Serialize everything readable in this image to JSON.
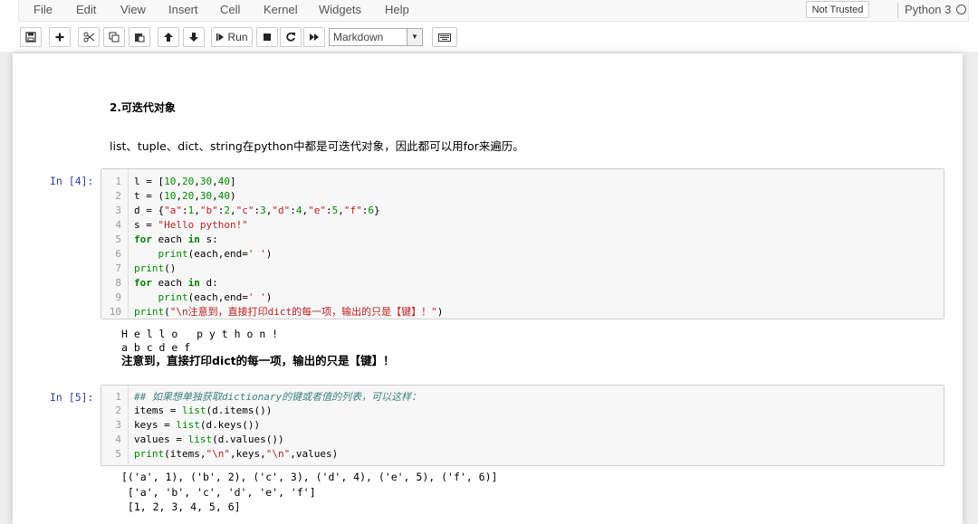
{
  "menu": [
    "File",
    "Edit",
    "View",
    "Insert",
    "Cell",
    "Kernel",
    "Widgets",
    "Help"
  ],
  "trusted_label": "Not Trusted",
  "kernel_name": "Python 3",
  "toolbar": {
    "run_label": "Run",
    "cell_type": "Markdown"
  },
  "markdown": {
    "heading": "2.可迭代对象",
    "paragraph": "list、tuple、dict、string在python中都是可迭代对象，因此都可以用for来遍历。"
  },
  "cells": [
    {
      "prompt": "In  [4]:",
      "lines": [
        "l = [10,20,30,40]",
        "t = (10,20,30,40)",
        "d = {\"a\":1,\"b\":2,\"c\":3,\"d\":4,\"e\":5,\"f\":6}",
        "s = \"Hello python!\"",
        "for each in s:",
        "    print(each,end=' ')",
        "print()",
        "for each in d:",
        "    print(each,end=' ')",
        "print(\"\\n注意到，直接打印dict的每一项，输出的只是【键】！\")"
      ],
      "output": [
        "H e l l o   p y t h o n !",
        "a b c d e f",
        "注意到，直接打印dict的每一项，输出的只是【键】！"
      ]
    },
    {
      "prompt": "In  [5]:",
      "lines": [
        "## 如果想单独获取dictionary的键或者值的列表，可以这样：",
        "items = list(d.items())",
        "keys = list(d.keys())",
        "values = list(d.values())",
        "print(items,\"\\n\",keys,\"\\n\",values)"
      ],
      "output": [
        "[('a', 1), ('b', 2), ('c', 3), ('d', 4), ('e', 5), ('f', 6)]",
        " ['a', 'b', 'c', 'd', 'e', 'f']",
        " [1, 2, 3, 4, 5, 6]"
      ]
    }
  ],
  "icons": [
    "save-icon",
    "plus-icon",
    "cut-icon",
    "copy-icon",
    "paste-icon",
    "arrow-up-icon",
    "arrow-down-icon",
    "run-icon",
    "stop-icon",
    "restart-icon",
    "fast-forward-icon",
    "keyboard-icon",
    "kernel-idle-icon"
  ]
}
